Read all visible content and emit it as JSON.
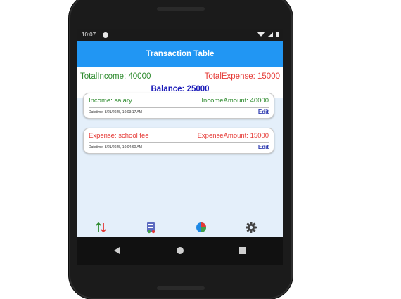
{
  "status_bar": {
    "time": "10:07"
  },
  "app_bar": {
    "title": "Transaction Table"
  },
  "summary": {
    "total_income": "TotalIncome: 40000",
    "total_expense": "TotalExpense: 15000",
    "balance": "Balance: 25000"
  },
  "transactions": [
    {
      "title": "Income: salary",
      "amount": "IncomeAmount: 40000",
      "datetime": "Datetime: 8/21/2025, 10:03:17 AM",
      "edit_label": "Edit"
    },
    {
      "title": "Expense: school fee",
      "amount": "ExpenseAmount: 15000",
      "datetime": "Datetime: 8/21/2025, 10:04:60 AM",
      "edit_label": "Edit"
    }
  ],
  "bottom_nav": {
    "items": [
      "transactions-icon",
      "report-icon",
      "pie-chart-icon",
      "settings-icon"
    ]
  },
  "colors": {
    "app_bar": "#2196f3",
    "income": "#2e8b2e",
    "expense": "#e53935",
    "balance": "#1a1ab8",
    "background": "#e4effa"
  }
}
